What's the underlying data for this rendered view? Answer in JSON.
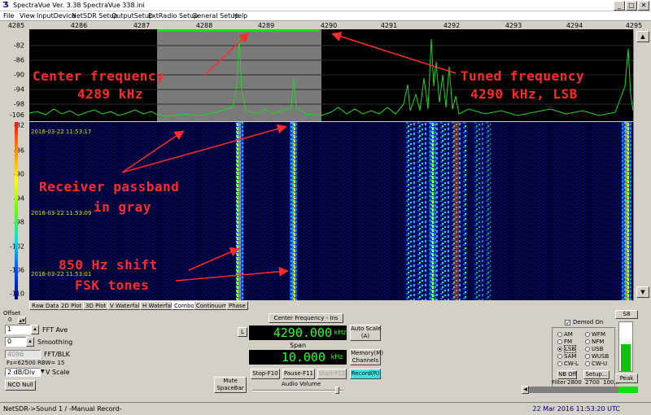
{
  "window": {
    "title": "SpectraVue Ver. 3.38  SpectraVue 338.ini",
    "minimize_glyph": "_",
    "maximize_glyph": "□",
    "close_glyph": "✕"
  },
  "menu": [
    "File",
    "View",
    "InputDevice",
    "NetSDR Setup",
    "OutputSetup",
    "ExtRadio Setup",
    "General Setup",
    "Help"
  ],
  "freq_axis": [
    "4285",
    "4286",
    "4287",
    "4288",
    "4289",
    "4290",
    "4291",
    "4292",
    "4293",
    "4294",
    "4295"
  ],
  "spectrum_db": [
    "-82",
    "-86",
    "-90",
    "-94",
    "-98",
    "-102",
    "-106"
  ],
  "waterfall_db": [
    "-82",
    "-86",
    "-90",
    "-94",
    "-98",
    "-102",
    "-106",
    "-110"
  ],
  "waterfall_times": [
    "2016-03-22 11:53:17",
    "2016-03-22 11:53:09",
    "2016-03-22 11:53:01"
  ],
  "annotations": {
    "center_1": "Center frequency",
    "center_2": "4289 kHz",
    "tuned_1": "Tuned frequency",
    "tuned_2": "4290 kHz, LSB",
    "passband_1": "Receiver passband",
    "passband_2": "in gray",
    "fsk_1": "850 Hz shift",
    "fsk_2": "FSK tones"
  },
  "tabs": [
    "Raw Data",
    "2D Plot",
    "3D Plot",
    "V Waterfall",
    "H Waterfall",
    "Combo",
    "Continuum",
    "Phase"
  ],
  "active_tab": "Combo",
  "left_panel": {
    "offset_label": "Offset",
    "offset_value": "0",
    "fft_ave_value": "1",
    "fft_ave_label": "FFT Ave",
    "smoothing_value": "0",
    "smoothing_label": "Smoothing",
    "fft_blk_value": "4096",
    "fft_blk_label": "FFT/BLK",
    "fs_text": "Fs=62500 RBW= 15",
    "vscale_value": "2 dB/Div",
    "vscale_label": "V Scale",
    "nco_null": "NCO Null"
  },
  "center_panel": {
    "center_freq_button": "Center Frequency - Ins",
    "l_button": "L",
    "frequency": "4290.000",
    "freq_unit": "kHz",
    "auto_scale_1": "Auto Scale",
    "auto_scale_2": "(A)",
    "span_label": "Span",
    "span_value": "10.000",
    "span_unit": "kHz",
    "memory_1": "Memory(M)",
    "memory_2": "Channels",
    "stop": "Stop-F10",
    "pause": "Pause-F11",
    "start": "Start-F12",
    "record": "Record(R)",
    "mute_1": "Mute",
    "mute_2": "SpaceBar",
    "audio_volume": "Audio Volume"
  },
  "demod": {
    "demod_on": "Demod On",
    "modes_left": [
      "AM",
      "FM",
      "LSB",
      "SAM",
      "CW-L"
    ],
    "modes_right": [
      "WFM",
      "NFM",
      "USB",
      "WUSB",
      "CW-U"
    ],
    "selected": "LSB",
    "nb_off": "NB Off",
    "setup": "Setup...",
    "s_reading": "S8",
    "s_level_fraction": 0.55,
    "peak": "Peak",
    "filter_label": "Filter",
    "filter_values": [
      "2800",
      "2700",
      "100..."
    ]
  },
  "status": {
    "left": "NetSDR->Sound 1  / -Manual Record-",
    "right": "22 Mar 2016  11:53:20 UTC"
  },
  "colors": {
    "trace": "#1fd81f",
    "annotation": "#ff2a2a",
    "passband": "#7a7a7a"
  }
}
